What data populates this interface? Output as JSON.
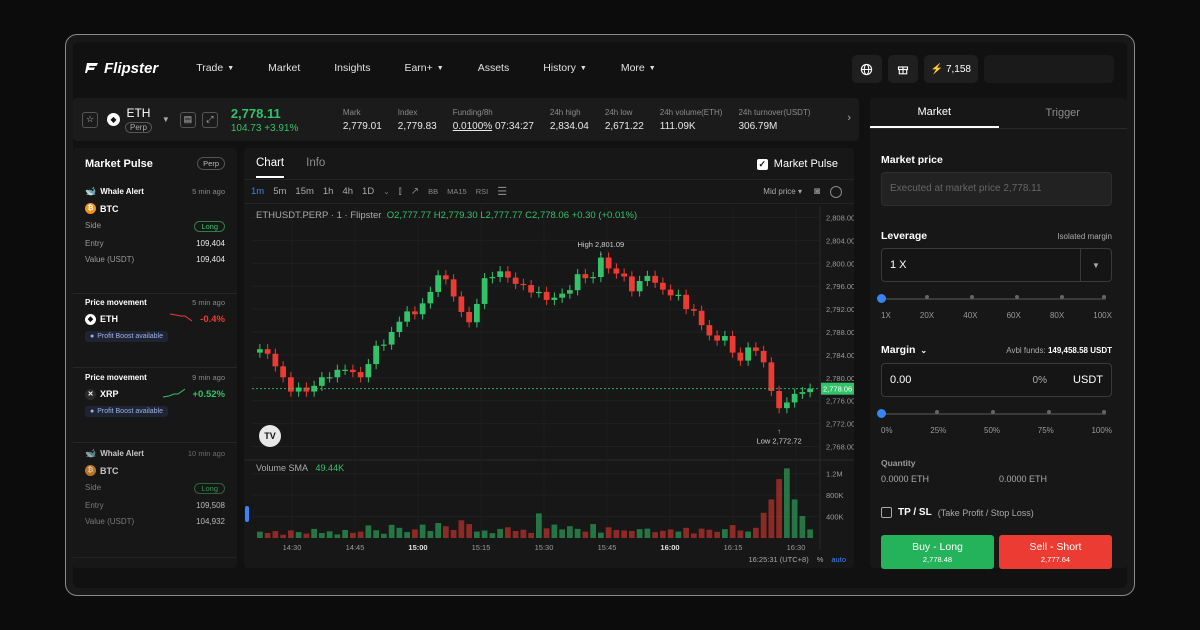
{
  "brand": "Flipster",
  "nav": {
    "items": [
      {
        "label": "Trade",
        "dropdown": true
      },
      {
        "label": "Market",
        "dropdown": false
      },
      {
        "label": "Insights",
        "dropdown": false
      },
      {
        "label": "Earn+",
        "dropdown": true
      },
      {
        "label": "Assets",
        "dropdown": false
      },
      {
        "label": "History",
        "dropdown": true
      },
      {
        "label": "More",
        "dropdown": true
      }
    ],
    "points": "7,158"
  },
  "ticker": {
    "symbol": "ETH",
    "badge": "Perp",
    "price": "2,778.11",
    "change": "104.73 +3.91%",
    "stats": [
      {
        "label": "Mark",
        "value": "2,779.01"
      },
      {
        "label": "Index",
        "value": "2,779.83"
      },
      {
        "label": "Funding/8h",
        "value": "0.0100%",
        "extra": "07:34:27"
      },
      {
        "label": "24h high",
        "value": "2,834.04"
      },
      {
        "label": "24h low",
        "value": "2,671.22"
      },
      {
        "label": "24h volume(ETH)",
        "value": "111.09K"
      },
      {
        "label": "24h turnover(USDT)",
        "value": "306.79M"
      }
    ]
  },
  "pulse": {
    "title": "Market Pulse",
    "badge": "Perp",
    "cards": [
      {
        "type": "Whale Alert",
        "time": "5 min ago",
        "coin": "BTC",
        "side_label": "Side",
        "side": "Long",
        "entry_label": "Entry",
        "entry": "109,404",
        "value_label": "Value (USDT)",
        "value": "109,404"
      },
      {
        "type": "Price movement",
        "time": "5 min ago",
        "coin": "ETH",
        "change": "-0.4%",
        "boost": "Profit Boost available"
      },
      {
        "type": "Price movement",
        "time": "9 min ago",
        "coin": "XRP",
        "change": "+0.52%",
        "boost": "Profit Boost available"
      },
      {
        "type": "Whale Alert",
        "time": "10 min ago",
        "coin": "BTC",
        "side_label": "Side",
        "side": "Long",
        "entry_label": "Entry",
        "entry": "109,508",
        "value_label": "Value (USDT)",
        "value": "104,932"
      }
    ]
  },
  "chart_panel": {
    "tabs": [
      "Chart",
      "Info"
    ],
    "market_pulse_label": "Market Pulse",
    "intervals": [
      "1m",
      "5m",
      "15m",
      "1h",
      "4h",
      "1D"
    ],
    "indicators": [
      "BB",
      "MA15",
      "RSI"
    ],
    "mid_price_label": "Mid price",
    "ohlc": {
      "symbol": "ETHUSDT.PERP · 1 · Flipster",
      "o": "O2,777.77",
      "h": "H2,779.30",
      "l": "L2,777.77",
      "c": "C2,778.06",
      "chg": "+0.30 (+0.01%)"
    },
    "volume_label": "Volume SMA",
    "volume_value": "49.44K",
    "high_label": "High 2,801.09",
    "low_label": "Low 2,772.72",
    "last_price_tag": "2,778.06",
    "clock": "16:25:31 (UTC+8)",
    "pct": "%",
    "auto": "auto",
    "colors": {
      "up": "#33c26a",
      "down": "#ec3b33",
      "accent": "#3a82f7"
    }
  },
  "chart_data": {
    "type": "candlestick",
    "price_axis": {
      "ticks": [
        "2,808.00",
        "2,804.00",
        "2,800.00",
        "2,796.00",
        "2,792.00",
        "2,788.00",
        "2,784.00",
        "2,780.00",
        "2,776.00",
        "2,772.00",
        "2,768.00"
      ],
      "ylim": [
        2766,
        2810
      ]
    },
    "volume_axis": {
      "ticks": [
        "1.2M",
        "800K",
        "400K"
      ]
    },
    "time_axis": [
      "14:30",
      "14:45",
      "15:00",
      "15:15",
      "15:30",
      "15:45",
      "16:00",
      "16:15",
      "16:30"
    ],
    "close": [
      2785.0,
      2784.2,
      2782.0,
      2780.1,
      2777.6,
      2778.3,
      2777.6,
      2778.6,
      2780.1,
      2780.1,
      2781.4,
      2781.4,
      2781.0,
      2780.1,
      2782.4,
      2785.6,
      2785.8,
      2788.0,
      2789.8,
      2791.6,
      2791.1,
      2793.0,
      2795.0,
      2797.9,
      2797.2,
      2794.2,
      2791.5,
      2789.7,
      2792.9,
      2797.4,
      2797.6,
      2798.6,
      2797.5,
      2796.4,
      2796.2,
      2794.9,
      2795.0,
      2793.6,
      2794.0,
      2794.7,
      2795.3,
      2798.1,
      2797.4,
      2797.6,
      2801.0,
      2799.1,
      2798.2,
      2797.7,
      2795.1,
      2796.9,
      2797.8,
      2796.6,
      2795.4,
      2794.4,
      2794.5,
      2792.0,
      2791.7,
      2789.2,
      2787.4,
      2786.5,
      2787.3,
      2784.4,
      2783.0,
      2785.3,
      2784.7,
      2782.7,
      2777.7,
      2774.7,
      2775.7,
      2777.2,
      2777.5,
      2778.1
    ],
    "volume_k": [
      118,
      95,
      130,
      60,
      142,
      110,
      83,
      170,
      92,
      125,
      66,
      150,
      97,
      120,
      235,
      145,
      80,
      245,
      190,
      110,
      160,
      250,
      130,
      280,
      220,
      150,
      330,
      260,
      120,
      140,
      90,
      170,
      200,
      130,
      155,
      95,
      460,
      180,
      250,
      160,
      220,
      170,
      120,
      260,
      100,
      200,
      150,
      140,
      130,
      165,
      175,
      110,
      135,
      160,
      120,
      190,
      85,
      175,
      155,
      115,
      165,
      240,
      140,
      120,
      190,
      470,
      720,
      1100,
      1300,
      720,
      410,
      160
    ]
  },
  "order_panel": {
    "tabs": [
      "Market",
      "Trigger"
    ],
    "market_price_label": "Market price",
    "market_price_placeholder": "Executed at market price 2,778.11",
    "leverage_label": "Leverage",
    "isolated_label": "Isolated margin",
    "leverage_value": "1 X",
    "leverage_ticks": [
      "1X",
      "20X",
      "40X",
      "60X",
      "80X",
      "100X"
    ],
    "margin_label": "Margin",
    "avbl_label": "Avbl funds:",
    "avbl_value": "149,458.58 USDT",
    "margin_value": "0.00",
    "margin_pct": "0%",
    "margin_unit": "USDT",
    "margin_ticks": [
      "0%",
      "25%",
      "50%",
      "75%",
      "100%"
    ],
    "quantity_label": "Quantity",
    "qty_long": "0.0000 ETH",
    "qty_short": "0.0000 ETH",
    "tpsl_label": "TP / SL",
    "tpsl_note": "(Take Profit / Stop Loss)",
    "buy_label": "Buy - Long",
    "buy_price": "2,778.48",
    "sell_label": "Sell - Short",
    "sell_price": "2,777.64"
  }
}
